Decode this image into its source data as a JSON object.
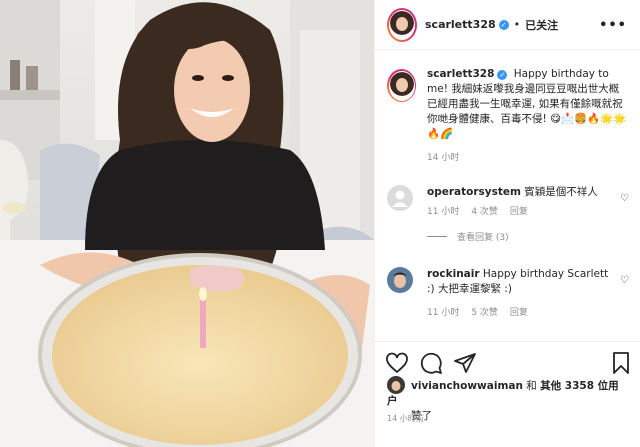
{
  "header": {
    "username": "scarlett328",
    "separator": "•",
    "follow_status": "已关注"
  },
  "caption": {
    "username": "scarlett328",
    "text": "Happy birthday to me! 我細妹返嚟我身邊同豆豆嘅出世大概已經用盡我一生嘅幸運, 如果有僅餘嘅就祝你哋身體健康、百毒不侵!",
    "emoji": "😋📩🍔🔥🌟🌟🔥🌈",
    "age": "14 小时"
  },
  "comments": [
    {
      "username": "operatorsystem",
      "text": "賓穎是個不祥人",
      "age": "11 小时",
      "likes": "4 次赞",
      "reply": "回复",
      "view_replies": "查看回复 (3)"
    },
    {
      "username": "rockinair",
      "text": "Happy birthday Scarlett :) 大把幸運黎緊 :)",
      "age": "11 小时",
      "likes": "5 次赞",
      "reply": "回复"
    }
  ],
  "likes": {
    "user": "vivianchowwaiman",
    "connector": "和",
    "others": "其他 3358 位用户",
    "suffix": "赞了"
  },
  "post_time": "14 小时前",
  "icons": [
    "like-icon",
    "comment-icon",
    "share-icon",
    "save-icon",
    "more-icon",
    "verified-icon"
  ],
  "colors": {
    "accent": "#3897f0",
    "text": "#262626",
    "muted": "#8e8e8e",
    "border": "#efefef"
  }
}
